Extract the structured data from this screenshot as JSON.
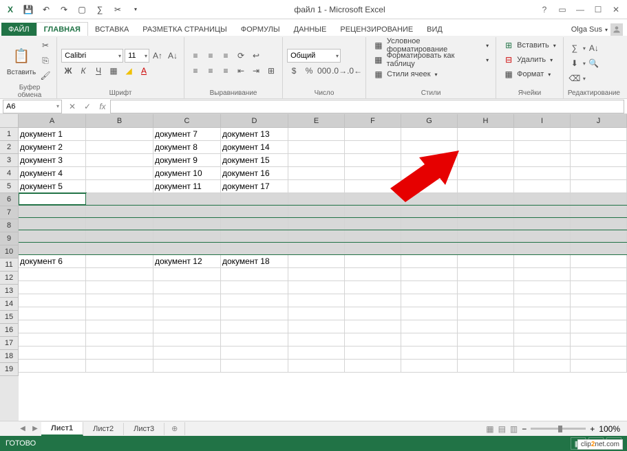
{
  "title": "файл 1 - Microsoft Excel",
  "user": "Olga Sus",
  "ribbon_tabs": {
    "file": "ФАЙЛ",
    "home": "ГЛАВНАЯ",
    "insert": "ВСТАВКА",
    "pagelayout": "РАЗМЕТКА СТРАНИЦЫ",
    "formulas": "ФОРМУЛЫ",
    "data": "ДАННЫЕ",
    "review": "РЕЦЕНЗИРОВАНИЕ",
    "view": "ВИД"
  },
  "ribbon": {
    "clipboard": {
      "paste": "Вставить",
      "label": "Буфер обмена"
    },
    "font": {
      "family": "Calibri",
      "size": "11",
      "label": "Шрифт"
    },
    "align": {
      "label": "Выравнивание"
    },
    "number": {
      "format": "Общий",
      "label": "Число"
    },
    "styles": {
      "cond": "Условное форматирование",
      "table": "Форматировать как таблицу",
      "cell": "Стили ячеек",
      "label": "Стили"
    },
    "cells": {
      "insert": "Вставить",
      "delete": "Удалить",
      "format": "Формат",
      "label": "Ячейки"
    },
    "editing": {
      "label": "Редактирование"
    }
  },
  "namebox": "A6",
  "formula": "",
  "columns": [
    "A",
    "B",
    "C",
    "D",
    "E",
    "F",
    "G",
    "H",
    "I",
    "J"
  ],
  "rows": {
    "r1": {
      "A": "документ 1",
      "C": "документ 7",
      "D": "документ 13"
    },
    "r2": {
      "A": "документ 2",
      "C": "документ 8",
      "D": "документ 14"
    },
    "r3": {
      "A": "документ 3",
      "C": "документ 9",
      "D": "документ 15"
    },
    "r4": {
      "A": "документ 4",
      "C": "документ 10",
      "D": "документ 16"
    },
    "r5": {
      "A": "документ 5",
      "C": "документ 11",
      "D": "документ 17"
    },
    "r11": {
      "A": "документ 6",
      "C": "документ 12",
      "D": "документ 18"
    }
  },
  "selected_rows": [
    6,
    7,
    8,
    9,
    10
  ],
  "active_cell": "A6",
  "row_count": 19,
  "sheets": {
    "s1": "Лист1",
    "s2": "Лист2",
    "s3": "Лист3"
  },
  "status": "ГОТОВО",
  "zoom": "100%",
  "watermark": {
    "a": "clip",
    "b": "2",
    "c": "net.com"
  }
}
